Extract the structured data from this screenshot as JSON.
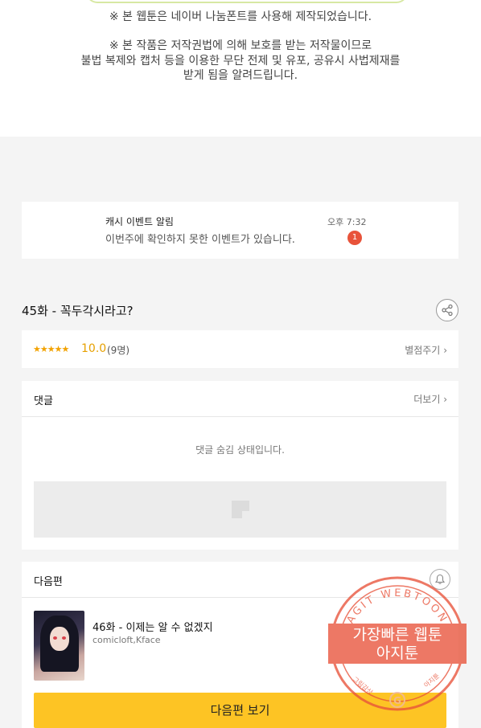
{
  "notice": {
    "font_notice": "※ 본 웹툰은 네이버 나눔폰트를 사용해 제작되었습니다.",
    "copyright_line1": "※ 본 작품은 저작권법에 의해 보호를 받는 저작물이므로",
    "copyright_line2": "불법 복제와 캡처 등을 이용한 무단 전제 및 유포, 공유시 사법제재를",
    "copyright_line3": "받게 됨을 알려드립니다."
  },
  "push": {
    "title": "캐시 이벤트 알림",
    "body": "이번주에 확인하지 못한 이벤트가 있습니다.",
    "time": "오후 7:32",
    "badge": "1"
  },
  "episode": {
    "title": "45화 - 꼭두각시라고?",
    "share_icon": "share-icon"
  },
  "rating": {
    "stars": "★★★★★",
    "score": "10.0",
    "count": "(9명)",
    "rate_link": "별점주기"
  },
  "comments": {
    "label": "댓글",
    "more": "더보기",
    "hidden_message": "댓글 숨김 상태입니다."
  },
  "next": {
    "label": "다음편",
    "title": "46화 - 이제는 알 수 없겠지",
    "author": "comicloft,Kface",
    "button": "다음편 보기",
    "bell_icon": "bell-icon"
  },
  "stamp": {
    "top_arc": "AGIT WEBTOON",
    "line1": "가장빠른 웹툰",
    "line2": "아지툰",
    "left_small": "그림감상",
    "right_small": "아지툰",
    "center_mark": "G"
  },
  "colors": {
    "accent": "#fdc424",
    "badge": "#e8533a",
    "star": "#f2a200",
    "stamp": "#e8533a"
  }
}
